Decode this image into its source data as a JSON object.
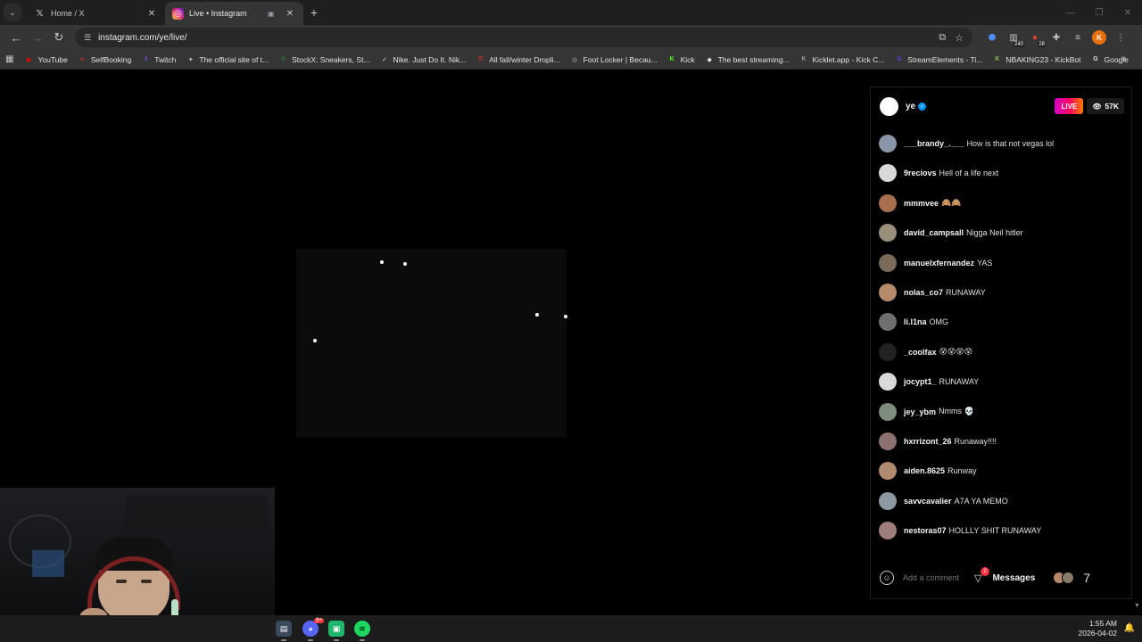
{
  "browser": {
    "tabs": [
      {
        "title": "Home / X",
        "icon": "x-logo-icon",
        "active": false
      },
      {
        "title": "Live • Instagram",
        "icon": "instagram-icon",
        "active": true
      }
    ],
    "url": "instagram.com/ye/live/"
  },
  "bookmarks": [
    {
      "label": "YouTube",
      "icon_color": "#ff0000",
      "glyph": "▶"
    },
    {
      "label": "SelfBooking",
      "icon_color": "#c33",
      "glyph": "✈"
    },
    {
      "label": "Twitch",
      "icon_color": "#9146ff",
      "glyph": "t"
    },
    {
      "label": "The official site of t...",
      "icon_color": "#c8c8c8",
      "glyph": "✦"
    },
    {
      "label": "StockX: Sneakers, St...",
      "icon_color": "#2e7d32",
      "glyph": "X"
    },
    {
      "label": "Nike. Just Do It. Nik...",
      "icon_color": "#e0e0e0",
      "glyph": "✓"
    },
    {
      "label": "All fall/winter Dropli...",
      "icon_color": "#d32f2f",
      "glyph": "S"
    },
    {
      "label": "Foot Locker | Becau...",
      "icon_color": "#bdbdbd",
      "glyph": "◎"
    },
    {
      "label": "Kick",
      "icon_color": "#53fc18",
      "glyph": "K"
    },
    {
      "label": "The best streaming...",
      "icon_color": "#e0e0e0",
      "glyph": "◆"
    },
    {
      "label": "Kicklet.app - Kick C...",
      "icon_color": "#9e9e9e",
      "glyph": "K"
    },
    {
      "label": "StreamElements - Ti...",
      "icon_color": "#5c3cf0",
      "glyph": "S"
    },
    {
      "label": "NBAKING23 - KickBot",
      "icon_color": "#8bc34a",
      "glyph": "K"
    },
    {
      "label": "Google",
      "icon_color": "#e0e0e0",
      "glyph": "G"
    }
  ],
  "live": {
    "username": "ye",
    "live_label": "LIVE",
    "viewers": "57K",
    "comments": [
      {
        "user": "___brandy_.___",
        "text": "How is that not vegas lol",
        "avatar": "#8a95a8"
      },
      {
        "user": "9reciovs",
        "text": "Hell of a life next",
        "avatar": "#d9d9d9"
      },
      {
        "user": "mmmvee",
        "text": "🙈🙈",
        "avatar": "#a86f4e"
      },
      {
        "user": "david_campsall",
        "text": "Nigga Neil hitler",
        "avatar": "#9a8f7a"
      },
      {
        "user": "manuelxfernandez",
        "text": "YAS",
        "avatar": "#7c6a58"
      },
      {
        "user": "nolas_co7",
        "text": "RUNAWAY",
        "avatar": "#b48a6a"
      },
      {
        "user": "li.l1na",
        "text": "OMG",
        "avatar": "#6f6f6f"
      },
      {
        "user": "_coolfax",
        "text": "😵😵😵😵",
        "avatar": "#222222"
      },
      {
        "user": "jocypt1_",
        "text": "RUNAWAY",
        "avatar": "#d9d9d9"
      },
      {
        "user": "jey_ybm",
        "text": "Nmms 💀",
        "avatar": "#7d8c7d"
      },
      {
        "user": "hxrrizont_26",
        "text": "Runaway!!!!",
        "avatar": "#8d7070"
      },
      {
        "user": "aiden.8625",
        "text": "Runway",
        "avatar": "#b08a6e"
      },
      {
        "user": "savvcavalier",
        "text": "A7A YA MEMO",
        "avatar": "#8e9aa3"
      },
      {
        "user": "nestoras07",
        "text": "HOLLLY SHIT RUNAWAY",
        "avatar": "#a07d7d"
      }
    ],
    "comment_placeholder": "Add a comment",
    "messages_label": "Messages",
    "messages_count": "2",
    "footer_number": "7"
  },
  "taskbar": {
    "discord_badge": "9+",
    "time": "1:55 AM",
    "date": "2026-04-02"
  }
}
